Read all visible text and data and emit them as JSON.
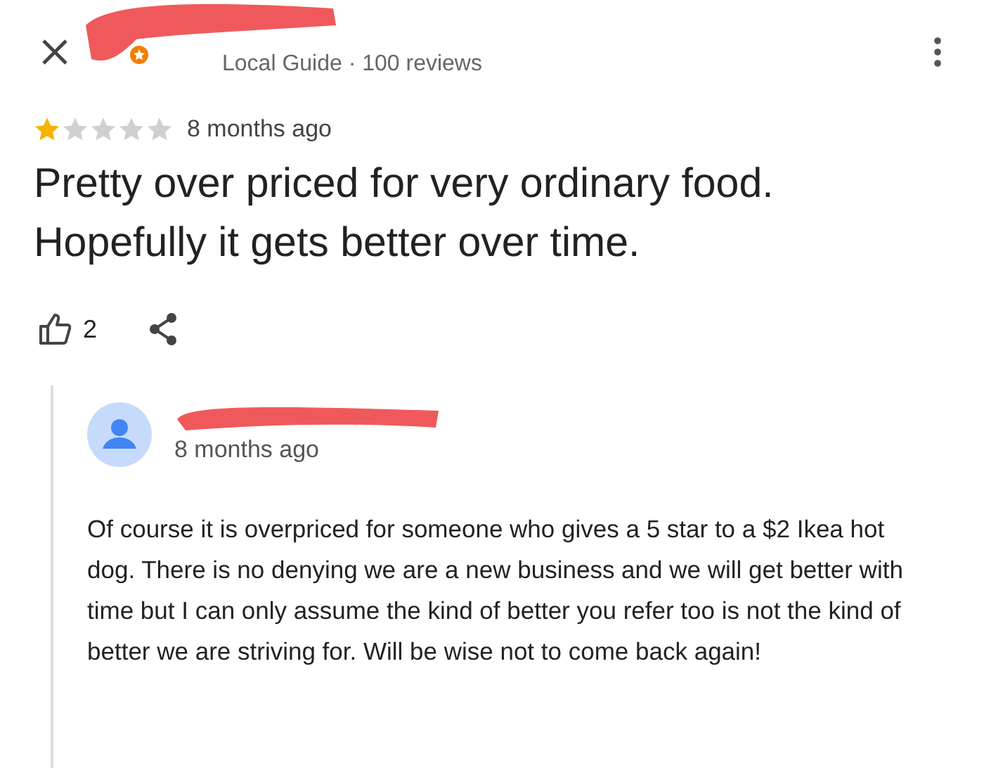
{
  "review": {
    "reviewer_meta": "Local Guide · 100 reviews",
    "stars": 1,
    "time": "8 months ago",
    "text": "Pretty over priced for very ordinary food. Hopefully it gets better over time.",
    "likes": "2"
  },
  "reply": {
    "time": "8 months ago",
    "text": "Of course it is overpriced for someone who gives a 5 star to a $2 Ikea hot dog.  There is no denying we are a new business and we will get better with time but I can only assume the kind of better you refer too is not the kind of better we are striving for. Will be wise not to come back again!"
  }
}
